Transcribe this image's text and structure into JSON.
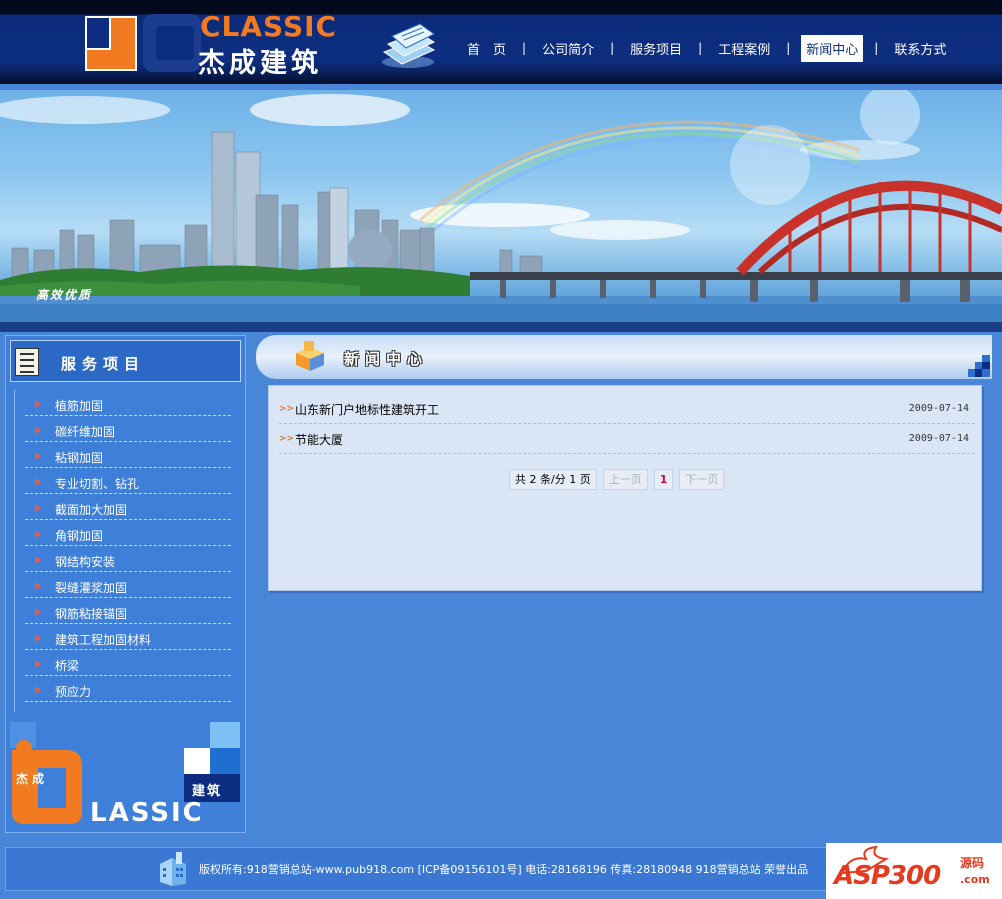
{
  "brand": {
    "name_en": "CLASSIC",
    "name_cn": "杰成建筑"
  },
  "nav": {
    "items": [
      {
        "label": "首　页"
      },
      {
        "label": "公司简介"
      },
      {
        "label": "服务项目"
      },
      {
        "label": "工程案例"
      },
      {
        "label": "新闻中心",
        "active": true
      },
      {
        "label": "联系方式"
      }
    ],
    "separator": "|"
  },
  "banner": {
    "slogan": "高效优质"
  },
  "sidebar": {
    "title": "服务项目",
    "items": [
      {
        "label": "植筋加固"
      },
      {
        "label": "碳纤维加固"
      },
      {
        "label": "粘钢加固"
      },
      {
        "label": "专业切割、钻孔"
      },
      {
        "label": "截面加大加固"
      },
      {
        "label": "角钢加固"
      },
      {
        "label": "钢结构安装"
      },
      {
        "label": "裂缝灌浆加固"
      },
      {
        "label": "钢筋粘接锚固"
      },
      {
        "label": "建筑工程加固材料"
      },
      {
        "label": "桥梁"
      },
      {
        "label": "预应力"
      }
    ],
    "logo": {
      "cn_left": "杰成",
      "cn_right": "建筑",
      "en": "LASSIC"
    }
  },
  "main": {
    "title": "新闻中心",
    "news": [
      {
        "title": "山东新门户地标性建筑开工",
        "date": "2009-07-14"
      },
      {
        "title": "节能大厦",
        "date": "2009-07-14"
      }
    ],
    "pager": {
      "summary": "共 2 条/分 1 页",
      "prev": "上一页",
      "current": "1",
      "next": "下一页"
    }
  },
  "footer": {
    "text": "版权所有:918营销总站-www.pub918.com  [ICP备09156101号] 电话:28168196 传真:28180948 918营销总站 荣誉出品"
  },
  "watermark": {
    "text": "ASP300",
    "cn": "源码",
    "suffix": ".com"
  },
  "colors": {
    "accent_orange": "#f27a21",
    "header_blue": "#0d2e80",
    "body_blue": "#4a86d8",
    "bullet_red": "#f05a3c"
  }
}
